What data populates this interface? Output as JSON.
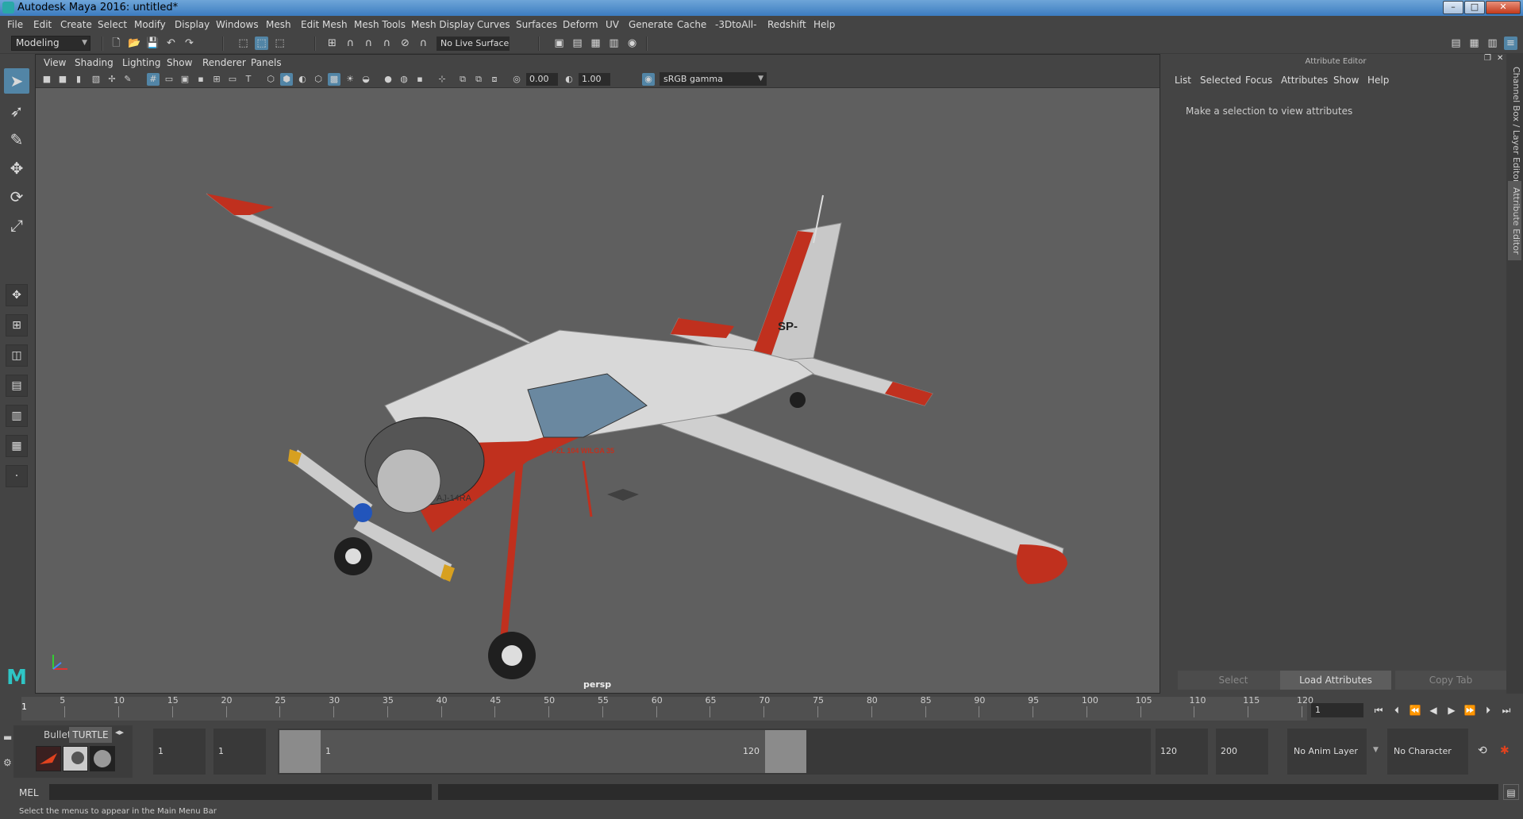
{
  "window": {
    "title": "Autodesk Maya 2016: untitled*",
    "min": "–",
    "max": "□",
    "close": "✕"
  },
  "menubar": [
    "File",
    "Edit",
    "Create",
    "Select",
    "Modify",
    "Display",
    "Windows",
    "Mesh",
    "Edit Mesh",
    "Mesh Tools",
    "Mesh Display",
    "Curves",
    "Surfaces",
    "Deform",
    "UV",
    "Generate",
    "Cache",
    "-3DtoAll-",
    "Redshift",
    "Help"
  ],
  "statusline": {
    "mode": "Modeling",
    "live_surface": "No Live Surface"
  },
  "viewport": {
    "panel_menu": [
      "View",
      "Shading",
      "Lighting",
      "Show",
      "Renderer",
      "Panels"
    ],
    "exposure": "0.00",
    "gamma": "1.00",
    "color_space": "sRGB gamma",
    "camera": "persp",
    "model": {
      "registration": "SP-",
      "nose_marking": "AJ-14RA",
      "fuselage_text": "PZL 104 WILGA 35"
    }
  },
  "attribute_editor": {
    "title": "Attribute Editor",
    "menu": [
      "List",
      "Selected",
      "Focus",
      "Attributes",
      "Show",
      "Help"
    ],
    "message": "Make a selection to view attributes",
    "buttons": {
      "select": "Select",
      "load": "Load Attributes",
      "copy": "Copy Tab"
    },
    "side_tabs": {
      "channel": "Channel Box / Layer Editor",
      "attr": "Attribute Editor"
    }
  },
  "timeslider": {
    "ticks": [
      "5",
      "10",
      "15",
      "20",
      "25",
      "30",
      "35",
      "40",
      "45",
      "50",
      "55",
      "60",
      "65",
      "70",
      "75",
      "80",
      "85",
      "90",
      "95",
      "100",
      "105",
      "110",
      "115",
      "120"
    ],
    "current_frame": "1",
    "current_frame_field": "1"
  },
  "rangebar": {
    "shelf_tabs": [
      "Bullet",
      "TURTLE"
    ],
    "start_frame": "1",
    "playback_start": "1",
    "range_start": "1",
    "range_end": "120",
    "playback_end": "120",
    "end_frame": "200",
    "anim_layer": "No Anim Layer",
    "character_set": "No Character Set"
  },
  "cmdline": {
    "language": "MEL",
    "help": "Select the menus to appear in the Main Menu Bar"
  }
}
